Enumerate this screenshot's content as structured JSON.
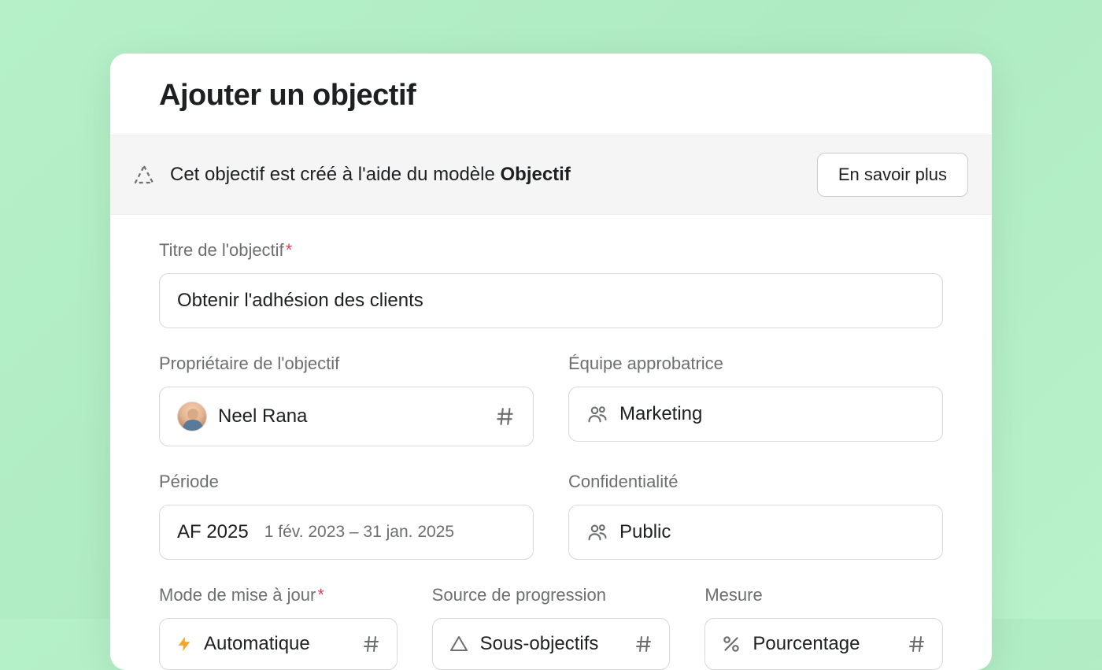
{
  "modal": {
    "title": "Ajouter un objectif"
  },
  "infoBar": {
    "prefix": "Cet objectif est créé à l'aide du modèle ",
    "templateName": "Objectif",
    "learnMore": "En savoir plus"
  },
  "fields": {
    "title": {
      "label": "Titre de l'objectif",
      "required": "*",
      "value": "Obtenir l'adhésion des clients"
    },
    "owner": {
      "label": "Propriétaire de l'objectif",
      "value": "Neel Rana"
    },
    "approvingTeam": {
      "label": "Équipe approbatrice",
      "value": "Marketing"
    },
    "period": {
      "label": "Période",
      "value": "AF 2025",
      "range": "1 fév. 2023 – 31 jan. 2025"
    },
    "confidentiality": {
      "label": "Confidentialité",
      "value": "Public"
    },
    "updateMode": {
      "label": "Mode de mise à jour",
      "required": "*",
      "value": "Automatique"
    },
    "progressSource": {
      "label": "Source de progression",
      "value": "Sous-objectifs"
    },
    "measure": {
      "label": "Mesure",
      "value": "Pourcentage"
    }
  }
}
